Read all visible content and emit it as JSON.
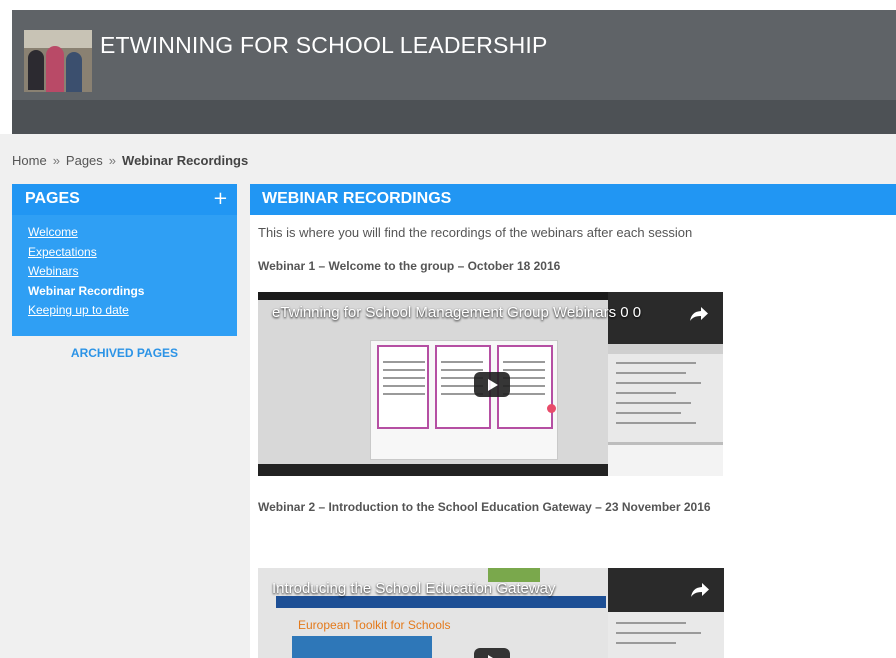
{
  "site": {
    "title": "ETWINNING FOR SCHOOL LEADERSHIP"
  },
  "breadcrumb": {
    "home": "Home",
    "separator": "»",
    "pages": "Pages",
    "current": "Webinar Recordings"
  },
  "sidebar": {
    "title": "PAGES",
    "add_icon": "+",
    "items": [
      {
        "label": "Welcome",
        "active": false
      },
      {
        "label": "Expectations",
        "active": false
      },
      {
        "label": "Webinars",
        "active": false
      },
      {
        "label": "Webinar Recordings",
        "active": true
      },
      {
        "label": "Keeping up to date",
        "active": false
      }
    ],
    "archived_label": "ARCHIVED PAGES"
  },
  "main": {
    "title": "WEBINAR RECORDINGS",
    "intro": "This is where you will find the recordings of the webinars after each session",
    "webinars": [
      {
        "title": "Webinar 1 – Welcome to the group – October 18 2016",
        "video_title": "eTwinning for School Management Group Webinars 0 0"
      },
      {
        "title": "Webinar 2 – Introduction to the School Education Gateway – 23 November 2016",
        "video_title": "Introducing the School Education Gateway",
        "slide_heading": "European Toolkit for Schools"
      }
    ]
  },
  "icons": {
    "share": "share-arrow-icon",
    "play": "play-icon"
  },
  "colors": {
    "header": "#5f6367",
    "accent_blue": "#2196f3",
    "archived_link": "#2b93e6"
  }
}
